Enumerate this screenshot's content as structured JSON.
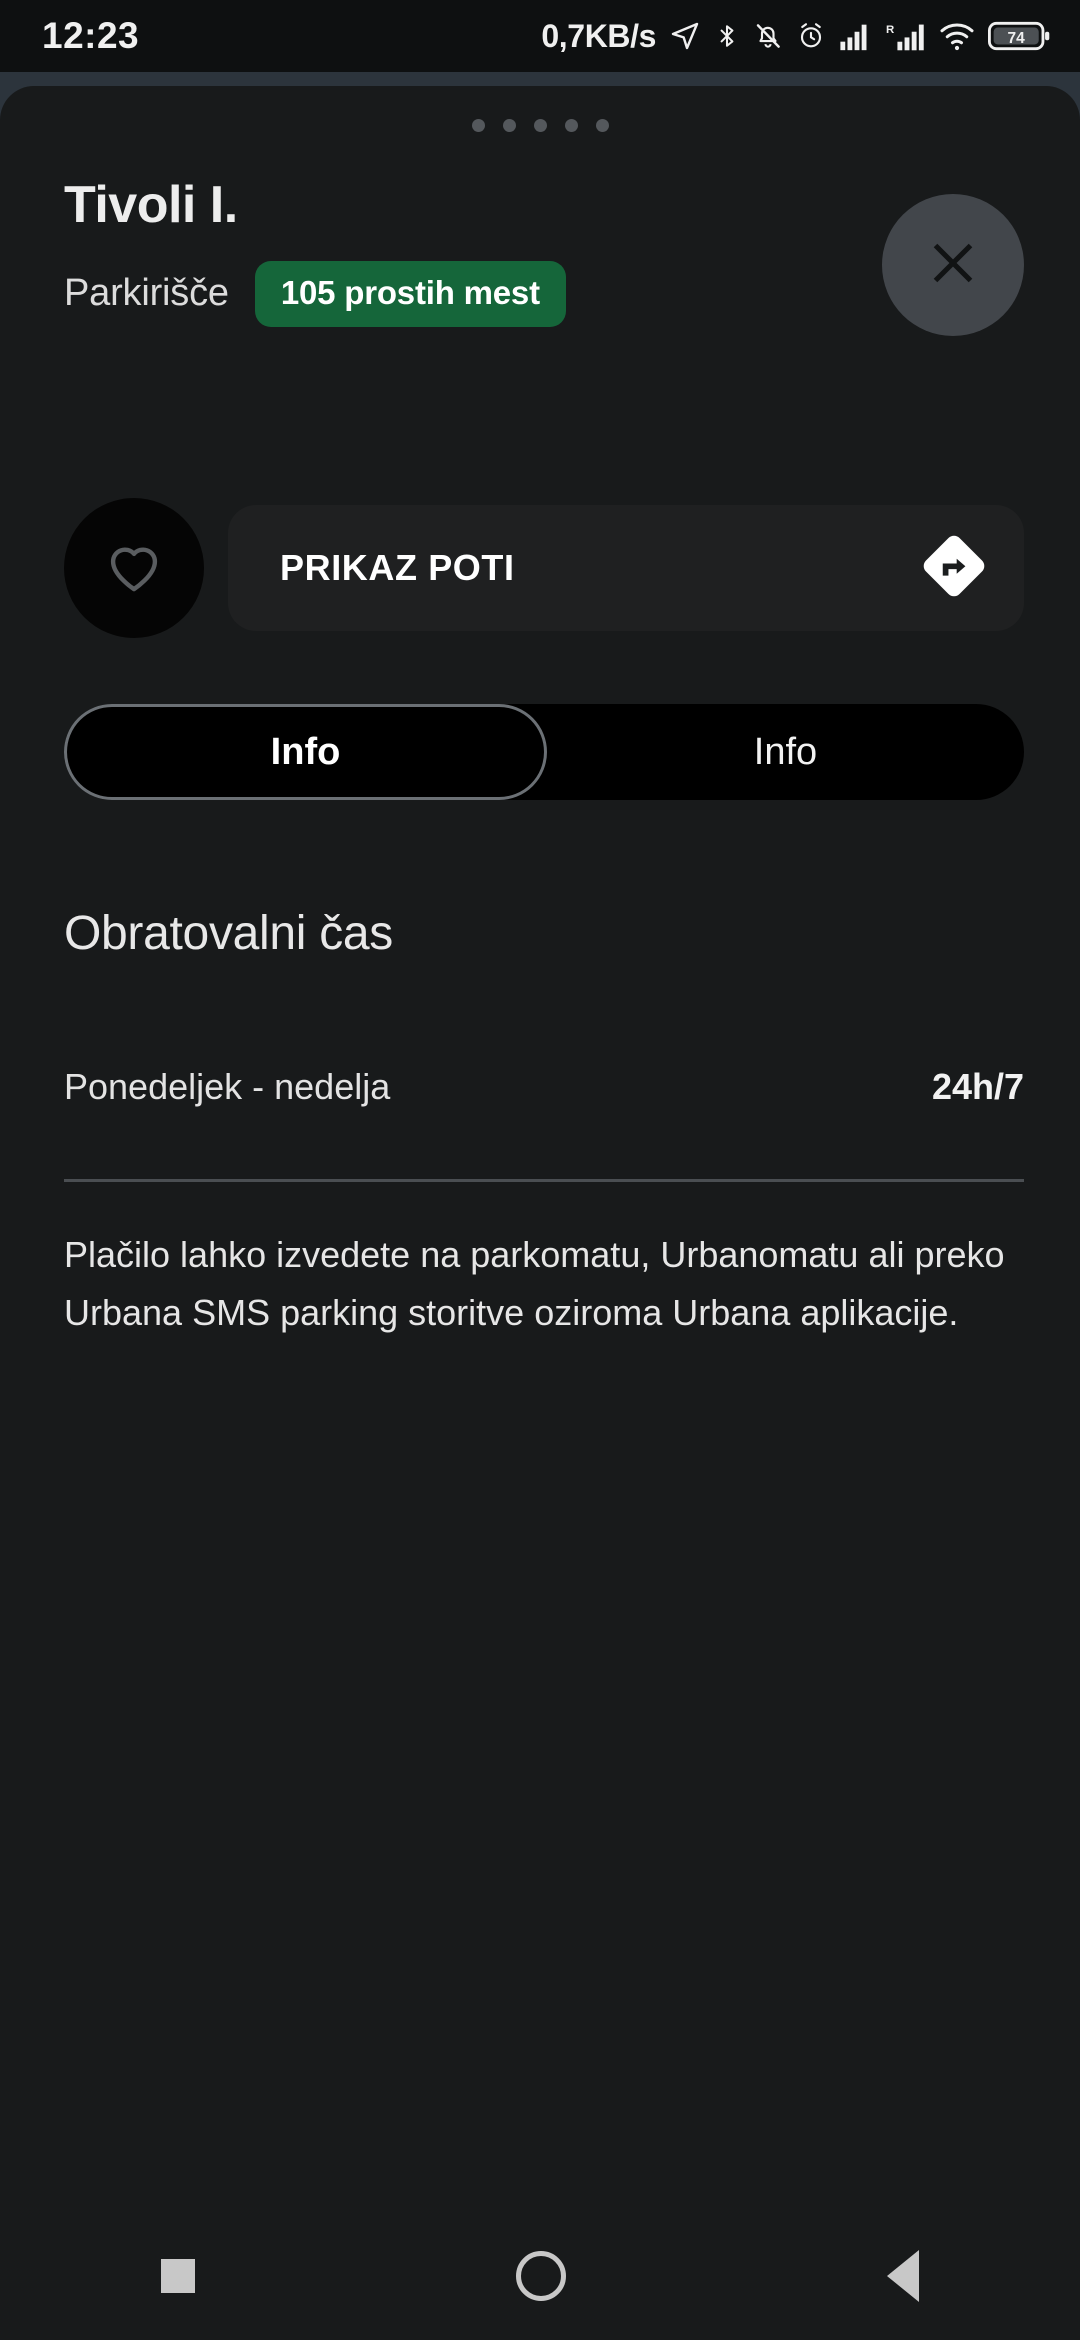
{
  "statusbar": {
    "clock": "12:23",
    "network_speed": "0,7KB/s",
    "battery_level": "74",
    "icons": [
      "location-arrow-icon",
      "bluetooth-icon",
      "notifications-muted-icon",
      "alarm-icon",
      "signal-bars-icon",
      "roaming-signal-icon",
      "wifi-icon",
      "battery-icon"
    ]
  },
  "sheet": {
    "grabber_dots": 5,
    "header": {
      "title": "Tivoli I.",
      "subtype": "Parkirišče",
      "badge": "105 prostih mest",
      "badge_color": "#15663a",
      "close_label": "×"
    },
    "actions": {
      "favorite_icon": "heart-icon",
      "route_label": "PRIKAZ POTI",
      "directions_icon": "directions-diamond-icon"
    },
    "tabs": [
      {
        "label": "Info",
        "active": true
      },
      {
        "label": "Info",
        "active": false
      }
    ],
    "content": {
      "section_title": "Obratovalni čas",
      "hours": {
        "day": "Ponedeljek - nedelja",
        "value": "24h/7"
      },
      "paragraph": "Plačilo lahko izvedete na parkomatu, Urbanomatu ali preko Urbana SMS parking storitve oziroma Urbana aplikacije."
    }
  },
  "navbar": {
    "recents_label": "recents",
    "home_label": "home",
    "back_label": "back"
  }
}
